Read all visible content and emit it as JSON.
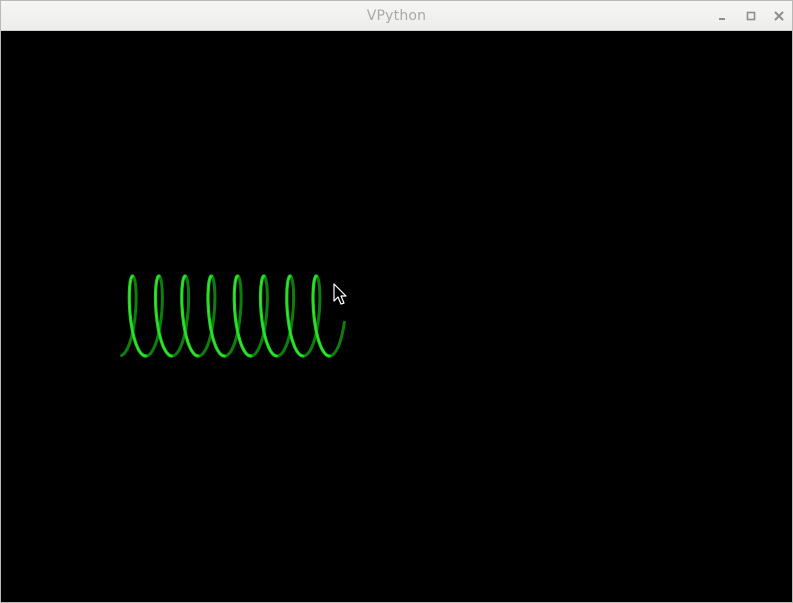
{
  "window": {
    "title": "VPython"
  },
  "title_buttons": {
    "minimize_icon": "minimize-icon",
    "maximize_icon": "maximize-icon",
    "close_icon": "close-icon"
  },
  "scene": {
    "background": "#000000",
    "objects": [
      {
        "type": "helix",
        "color": "#1ad31a",
        "coils": 8
      }
    ],
    "cursor_icon": "arrow-cursor-icon"
  }
}
